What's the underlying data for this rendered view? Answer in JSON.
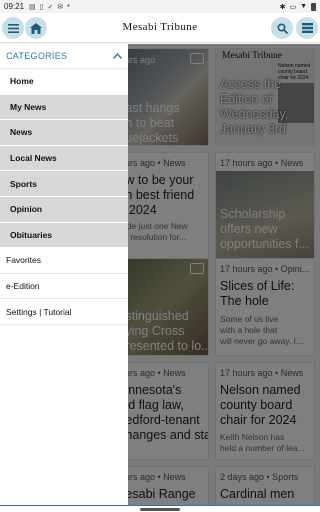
{
  "status_bar": {
    "time": "09:21",
    "left_icons": [
      "notification-icon",
      "sim-icon",
      "check-icon",
      "mail-icon",
      "dot-icon"
    ],
    "right_icons": [
      "bluetooth-icon",
      "vibrate-icon",
      "wifi-icon",
      "battery-icon"
    ]
  },
  "app_bar": {
    "logo": "Mesabi Tribune",
    "accent_color": "#c8dee8"
  },
  "drawer": {
    "categories_label": "CATEGORIES",
    "items": [
      "Home",
      "My News",
      "News",
      "Local News",
      "Sports",
      "Opinion",
      "Obituaries"
    ],
    "footer_items": [
      "Favorites",
      "e-Edition",
      "Settings | Tutorial"
    ]
  },
  "feed": {
    "cards": [
      {
        "meta": "hours ago",
        "title": "...ast hangs\n...n to beat\n...uejackets"
      },
      {
        "masthead": "Mesabi Tribune",
        "title": "Access the\nEdition of\nWednesday,\nJanuary 3rd",
        "inset": "Nelson named county board chair for 2024"
      },
      {
        "meta": "hours ago • News",
        "title": "...w to be your\n...n best friend\n... 2024",
        "snippet": "...ade just one New\n...'s resolution for..."
      },
      {
        "meta": "17 hours ago • News",
        "title": "Scholarship\noffers new\nopportunities f..."
      },
      {
        "meta": "",
        "title": "...stinguished\n...ying Cross\n...resented to lo..."
      },
      {
        "meta": "17 hours ago • Opini...",
        "title": "Slices of Life:\nThe hole",
        "snippet": "Some of us live\nwith a hole that\nwill never go away. I..."
      },
      {
        "meta": "hours ago • News",
        "title": "...innesota's\n...ld flag law,\n...edford-tenant\n...hanges and sta..."
      },
      {
        "meta": "17 hours ago • News",
        "title": "Nelson named\ncounty board\nchair for 2024",
        "snippet": "Keith Nelson has\nheld a number of lea..."
      },
      {
        "meta": "hours ago • News",
        "title": "...esabi Range"
      },
      {
        "meta": "2 days ago • Sports",
        "title": "Cardinal men"
      }
    ]
  }
}
